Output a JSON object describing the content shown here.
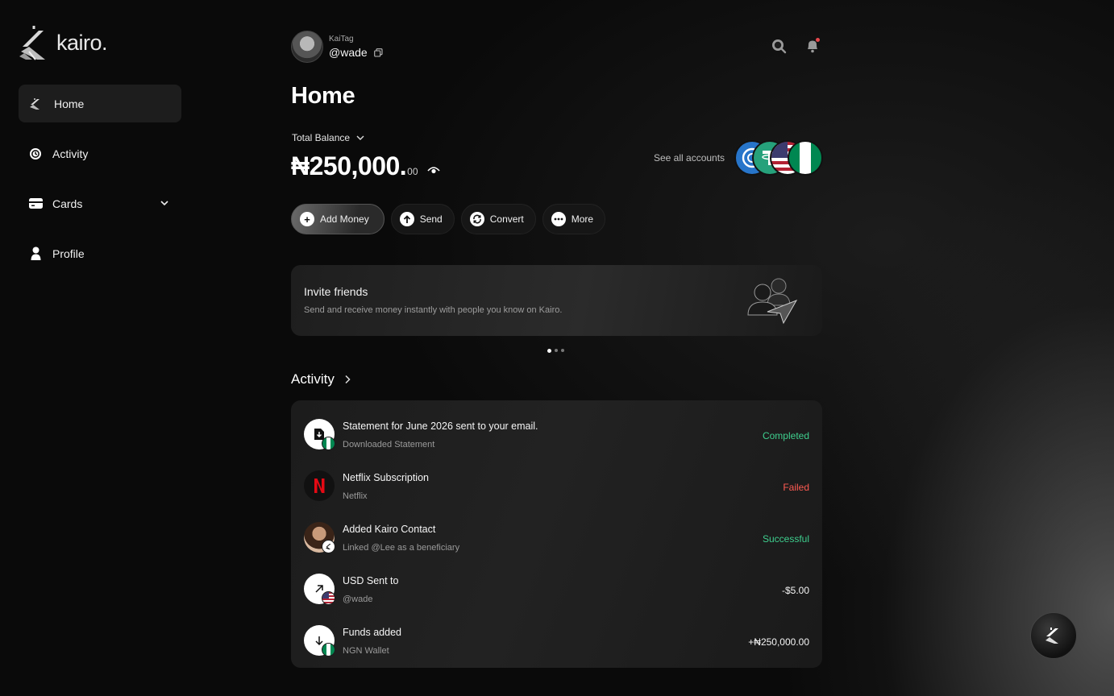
{
  "brand": {
    "name": "kairo."
  },
  "sidebar": {
    "items": [
      {
        "label": "Home",
        "icon": "kairo-logo-icon",
        "active": true
      },
      {
        "label": "Activity",
        "icon": "activity-icon"
      },
      {
        "label": "Cards",
        "icon": "card-icon",
        "expandable": true
      },
      {
        "label": "Profile",
        "icon": "user-icon"
      }
    ]
  },
  "user": {
    "tag_label": "KaiTag",
    "handle": "@wade"
  },
  "header": {
    "title": "Home"
  },
  "balance": {
    "label": "Total Balance",
    "amount": "₦250,000.",
    "decimals": "00",
    "see_all": "See all accounts",
    "account_flags": [
      "usdc",
      "usdt",
      "usa",
      "nigeria"
    ]
  },
  "actions": [
    {
      "label": "Add Money",
      "icon": "plus-icon"
    },
    {
      "label": "Send",
      "icon": "arrow-up-icon"
    },
    {
      "label": "Convert",
      "icon": "convert-icon"
    },
    {
      "label": "More",
      "icon": "more-icon"
    }
  ],
  "invite": {
    "title": "Invite friends",
    "subtitle": "Send and receive money instantly with people you know on Kairo.",
    "pages": 3,
    "current_page": 1
  },
  "activity": {
    "title": "Activity",
    "items": [
      {
        "title": "Statement for June 2026 sent to your email.",
        "subtitle": "Downloaded Statement",
        "status": "Completed",
        "status_color": "#3ecf8e",
        "icon": "document-icon",
        "badge": "nigeria-flag"
      },
      {
        "title": "Netflix Subscription",
        "subtitle": "Netflix",
        "status": "Failed",
        "status_color": "#ff5a52",
        "icon": "netflix-icon"
      },
      {
        "title": "Added Kairo Contact",
        "subtitle": "Linked @Lee as a beneficiary",
        "status": "Successful",
        "status_color": "#3ecf8e",
        "icon": "contact-avatar",
        "badge": "kairo-badge"
      },
      {
        "title": "USD Sent to",
        "subtitle": "@wade",
        "status": "-$5.00",
        "status_color": "#f5f5f5",
        "icon": "arrow-outgoing-icon",
        "badge": "usa-flag"
      },
      {
        "title": "Funds added",
        "subtitle": "NGN Wallet",
        "status": "+₦250,000.00",
        "status_color": "#f5f5f5",
        "icon": "arrow-down-icon",
        "badge": "nigeria-flag"
      }
    ]
  },
  "colors": {
    "success": "#3ecf8e",
    "error": "#ff5a52",
    "background": "#0a0a0a"
  }
}
